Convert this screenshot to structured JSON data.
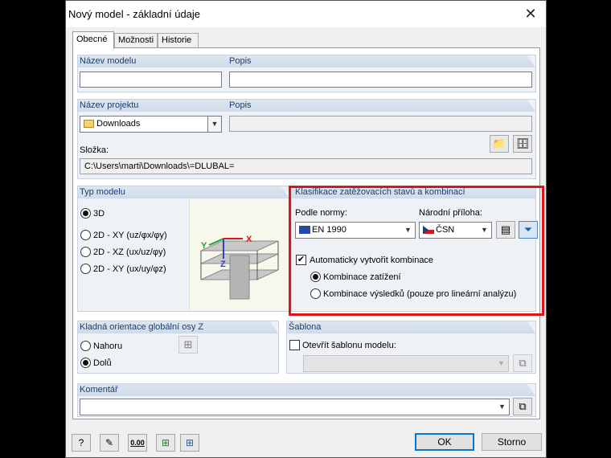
{
  "window": {
    "title": "Nový model - základní údaje",
    "close_icon": "close-icon"
  },
  "tabs": [
    {
      "label": "Obecné"
    },
    {
      "label": "Možnosti"
    },
    {
      "label": "Historie"
    }
  ],
  "model": {
    "name_label": "Název modelu",
    "name_value": "",
    "desc_label": "Popis",
    "desc_value": ""
  },
  "project": {
    "name_label": "Název projektu",
    "name_value": "Downloads",
    "desc_label": "Popis",
    "desc_value": "",
    "folder_label": "Složka:",
    "folder_value": "C:\\Users\\marti\\Downloads\\=DLUBAL="
  },
  "model_type": {
    "title": "Typ modelu",
    "options": [
      {
        "label": "3D",
        "selected": true
      },
      {
        "label": "2D - XY (uz/φx/φy)",
        "selected": false
      },
      {
        "label": "2D - XZ (ux/uz/φy)",
        "selected": false
      },
      {
        "label": "2D - XY (ux/uy/φz)",
        "selected": false
      }
    ]
  },
  "classification": {
    "title": "Klasifikace zatěžovacích stavů a kombinací",
    "norm_label": "Podle normy:",
    "norm_value": "EN 1990",
    "annex_label": "Národní příloha:",
    "annex_value": "ČSN",
    "auto_label": "Automaticky vytvořit kombinace",
    "auto_checked": true,
    "options": [
      {
        "label": "Kombinace zatížení",
        "selected": true
      },
      {
        "label": "Kombinace výsledků (pouze pro lineární analýzu)",
        "selected": false
      }
    ]
  },
  "orientation": {
    "title": "Kladná orientace globální osy Z",
    "options": [
      {
        "label": "Nahoru",
        "selected": false
      },
      {
        "label": "Dolů",
        "selected": true
      }
    ]
  },
  "template": {
    "title": "Šablona",
    "open_label": "Otevřít šablonu modelu:",
    "open_checked": false,
    "value": ""
  },
  "comment": {
    "title": "Komentář",
    "value": ""
  },
  "preview_axes": {
    "x": "X",
    "y": "Y",
    "z": "Z"
  },
  "buttons": {
    "ok": "OK",
    "cancel": "Storno"
  },
  "units_icon_text": "0.00",
  "colors": {
    "highlight": "#d8161b",
    "header": "#cfdbe9",
    "accent": "#0078d7"
  }
}
